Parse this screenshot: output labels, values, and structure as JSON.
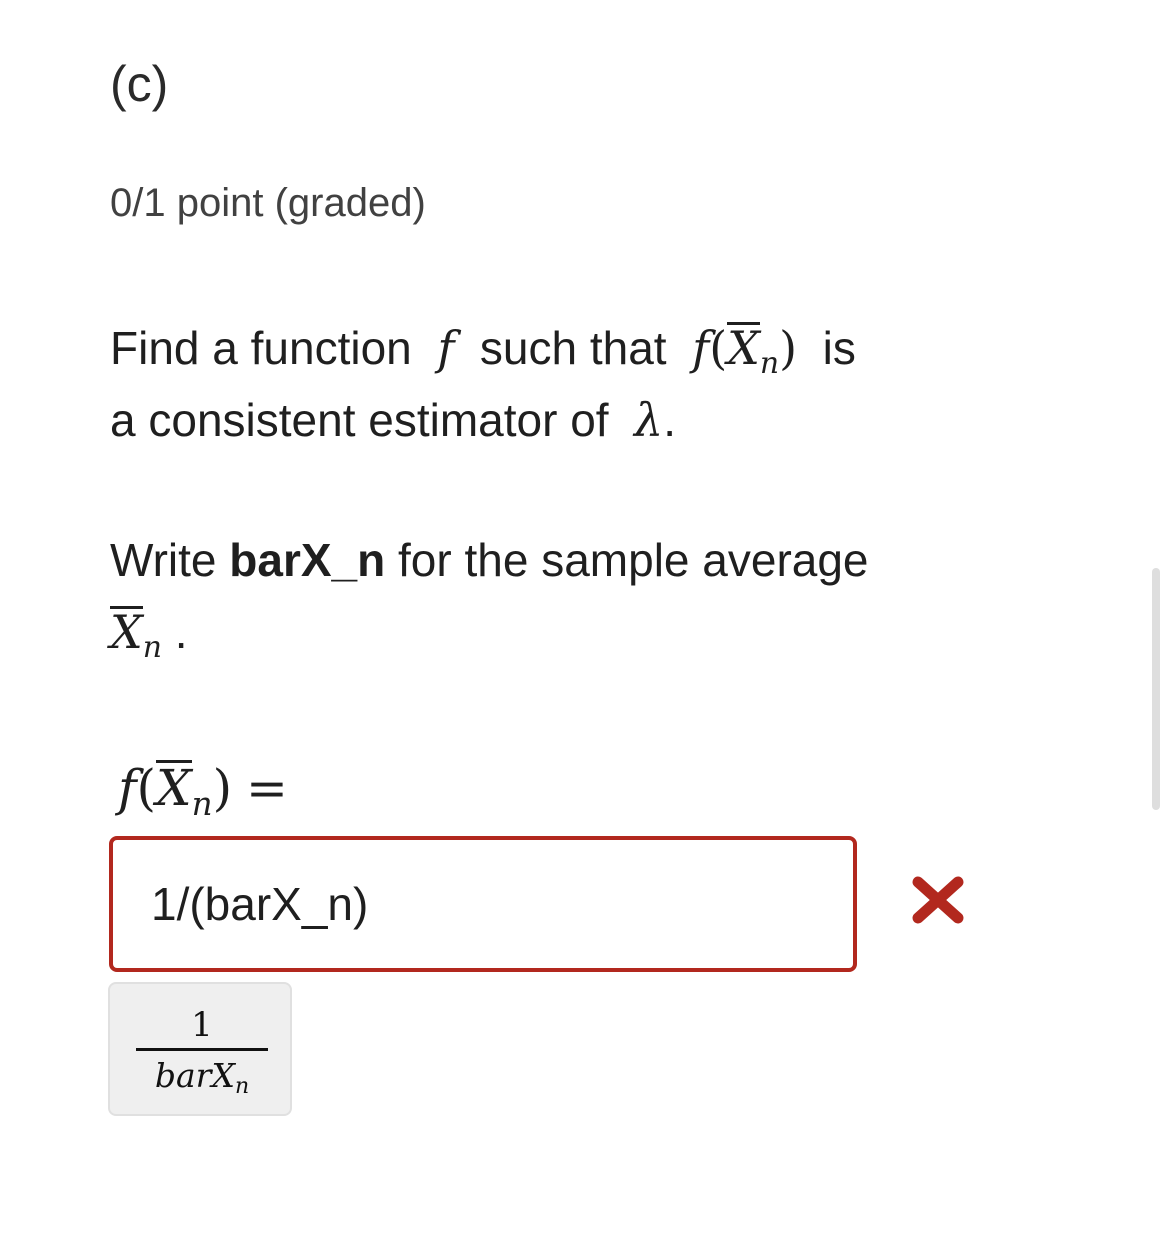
{
  "problem": {
    "heading": "(c)",
    "points": "0/1 point (graded)",
    "question_part1": "Find a function",
    "question_f": "f",
    "question_part2": "such that",
    "question_fx_f": "f",
    "question_fx_X": "X",
    "question_fx_n": "n",
    "question_part3": "is",
    "question_line2": "a consistent estimator of",
    "question_lambda": "λ",
    "question_period": ".",
    "instruction_prefix": "Write",
    "instruction_bold": "barX_n",
    "instruction_suffix": "for the sample average",
    "instruction_X": "X",
    "instruction_n": "n",
    "instruction_period": ".",
    "prompt_f": "f",
    "prompt_X": "X",
    "prompt_n": "n",
    "prompt_eq": "="
  },
  "answer": {
    "value": "1/(barX_n)",
    "status": "incorrect",
    "status_icon": "cross-icon",
    "status_color": "#b2281e",
    "border_color": "#b2281e"
  },
  "preview": {
    "numerator": "1",
    "denominator_base": "barX",
    "denominator_sub": "n"
  }
}
